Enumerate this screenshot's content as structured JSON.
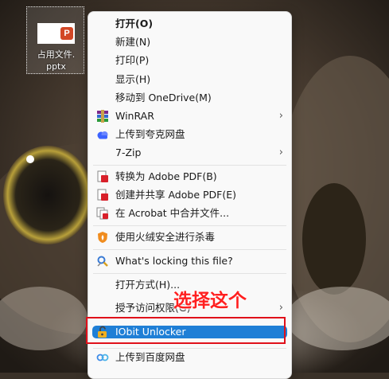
{
  "desktop": {
    "file_name_line1": "占用文件.",
    "file_name_line2": "pptx",
    "file_badge": "P"
  },
  "menu": {
    "items": [
      {
        "label": "打开(O)",
        "bold": true
      },
      {
        "label": "新建(N)"
      },
      {
        "label": "打印(P)"
      },
      {
        "label": "显示(H)"
      },
      {
        "label": "移动到 OneDrive(M)"
      },
      {
        "label": "WinRAR",
        "icon": "winrar-icon",
        "submenu": true
      },
      {
        "label": "上传到夸克网盘",
        "icon": "quark-cloud-icon"
      },
      {
        "label": "7-Zip",
        "submenu": true
      },
      {
        "label": "转换为 Adobe PDF(B)",
        "icon": "adobe-pdf-icon"
      },
      {
        "label": "创建并共享 Adobe PDF(E)",
        "icon": "adobe-pdf-icon"
      },
      {
        "label": "在 Acrobat 中合并文件...",
        "icon": "acrobat-merge-icon"
      },
      {
        "label": "使用火绒安全进行杀毒",
        "icon": "huorong-shield-icon"
      },
      {
        "label": "What's locking this file?",
        "icon": "lock-search-icon"
      },
      {
        "label": "打开方式(H)..."
      },
      {
        "label": "授予访问权限(G)",
        "submenu": true
      },
      {
        "label": "IObit Unlocker",
        "icon": "iobit-unlocker-icon",
        "highlighted": true
      },
      {
        "label": "上传到百度网盘",
        "icon": "baidu-cloud-icon"
      }
    ]
  },
  "annotation": {
    "text": "选择这个",
    "color": "#ff2020"
  },
  "colors": {
    "highlight": "#1f7fd6",
    "annotation_box": "#e0101a"
  }
}
